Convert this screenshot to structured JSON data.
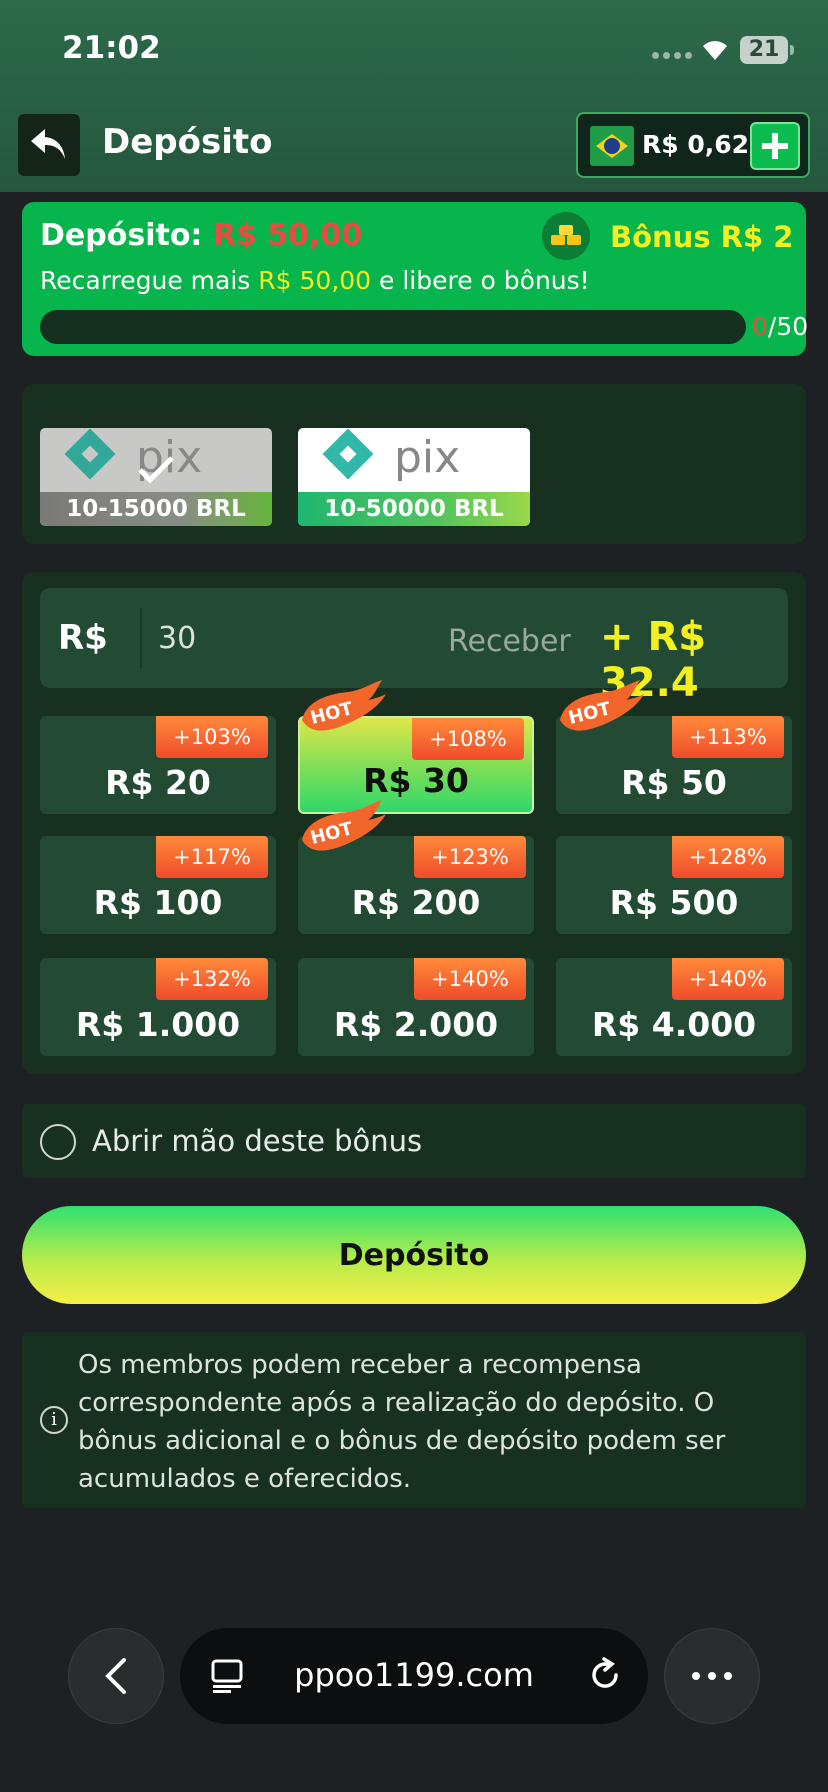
{
  "status_bar": {
    "time": "21:02",
    "battery": "21"
  },
  "header": {
    "title": "Depósito",
    "balance": "R$ 0,62"
  },
  "bonus": {
    "deposit_label": "Depósito:",
    "deposit_amount": "R$ 50,00",
    "bonus_label": "Bônus R$ 2",
    "msg_pre": "Recarregue mais ",
    "msg_amount": "R$ 50,00",
    "msg_post": " e libere o bônus!",
    "progress_current": "0",
    "progress_total": "/50",
    "progress_fraction": 0
  },
  "methods": [
    {
      "range": "10-15000 BRL",
      "selected": true
    },
    {
      "range": "10-50000 BRL",
      "selected": false
    }
  ],
  "amount": {
    "currency": "R$",
    "value": "30",
    "receive_label": "Receber",
    "receive_value": "+ R$ 32.4"
  },
  "tiles": [
    {
      "label": "R$ 20",
      "badge": "+103%",
      "hot": false,
      "selected": false
    },
    {
      "label": "R$ 30",
      "badge": "+108%",
      "hot": true,
      "selected": true
    },
    {
      "label": "R$ 50",
      "badge": "+113%",
      "hot": true,
      "selected": false
    },
    {
      "label": "R$ 100",
      "badge": "+117%",
      "hot": false,
      "selected": false
    },
    {
      "label": "R$ 200",
      "badge": "+123%",
      "hot": true,
      "selected": false
    },
    {
      "label": "R$ 500",
      "badge": "+128%",
      "hot": false,
      "selected": false
    },
    {
      "label": "R$ 1.000",
      "badge": "+132%",
      "hot": false,
      "selected": false
    },
    {
      "label": "R$ 2.000",
      "badge": "+140%",
      "hot": false,
      "selected": false
    },
    {
      "label": "R$ 4.000",
      "badge": "+140%",
      "hot": false,
      "selected": false
    }
  ],
  "hot_label": "HOT",
  "forfeit_label": "Abrir mão deste bônus",
  "deposit_button": "Depósito",
  "info_text": "Os membros podem receber a recompensa correspondente após a realização do depósito. O bônus adicional e o bônus de depósito podem ser acumulados e oferecidos.",
  "browser": {
    "url": "ppoo1199.com"
  },
  "colors": {
    "accent_green": "#07b54c",
    "highlight_yellow": "#f3f020",
    "alert_red": "#e94b40"
  }
}
